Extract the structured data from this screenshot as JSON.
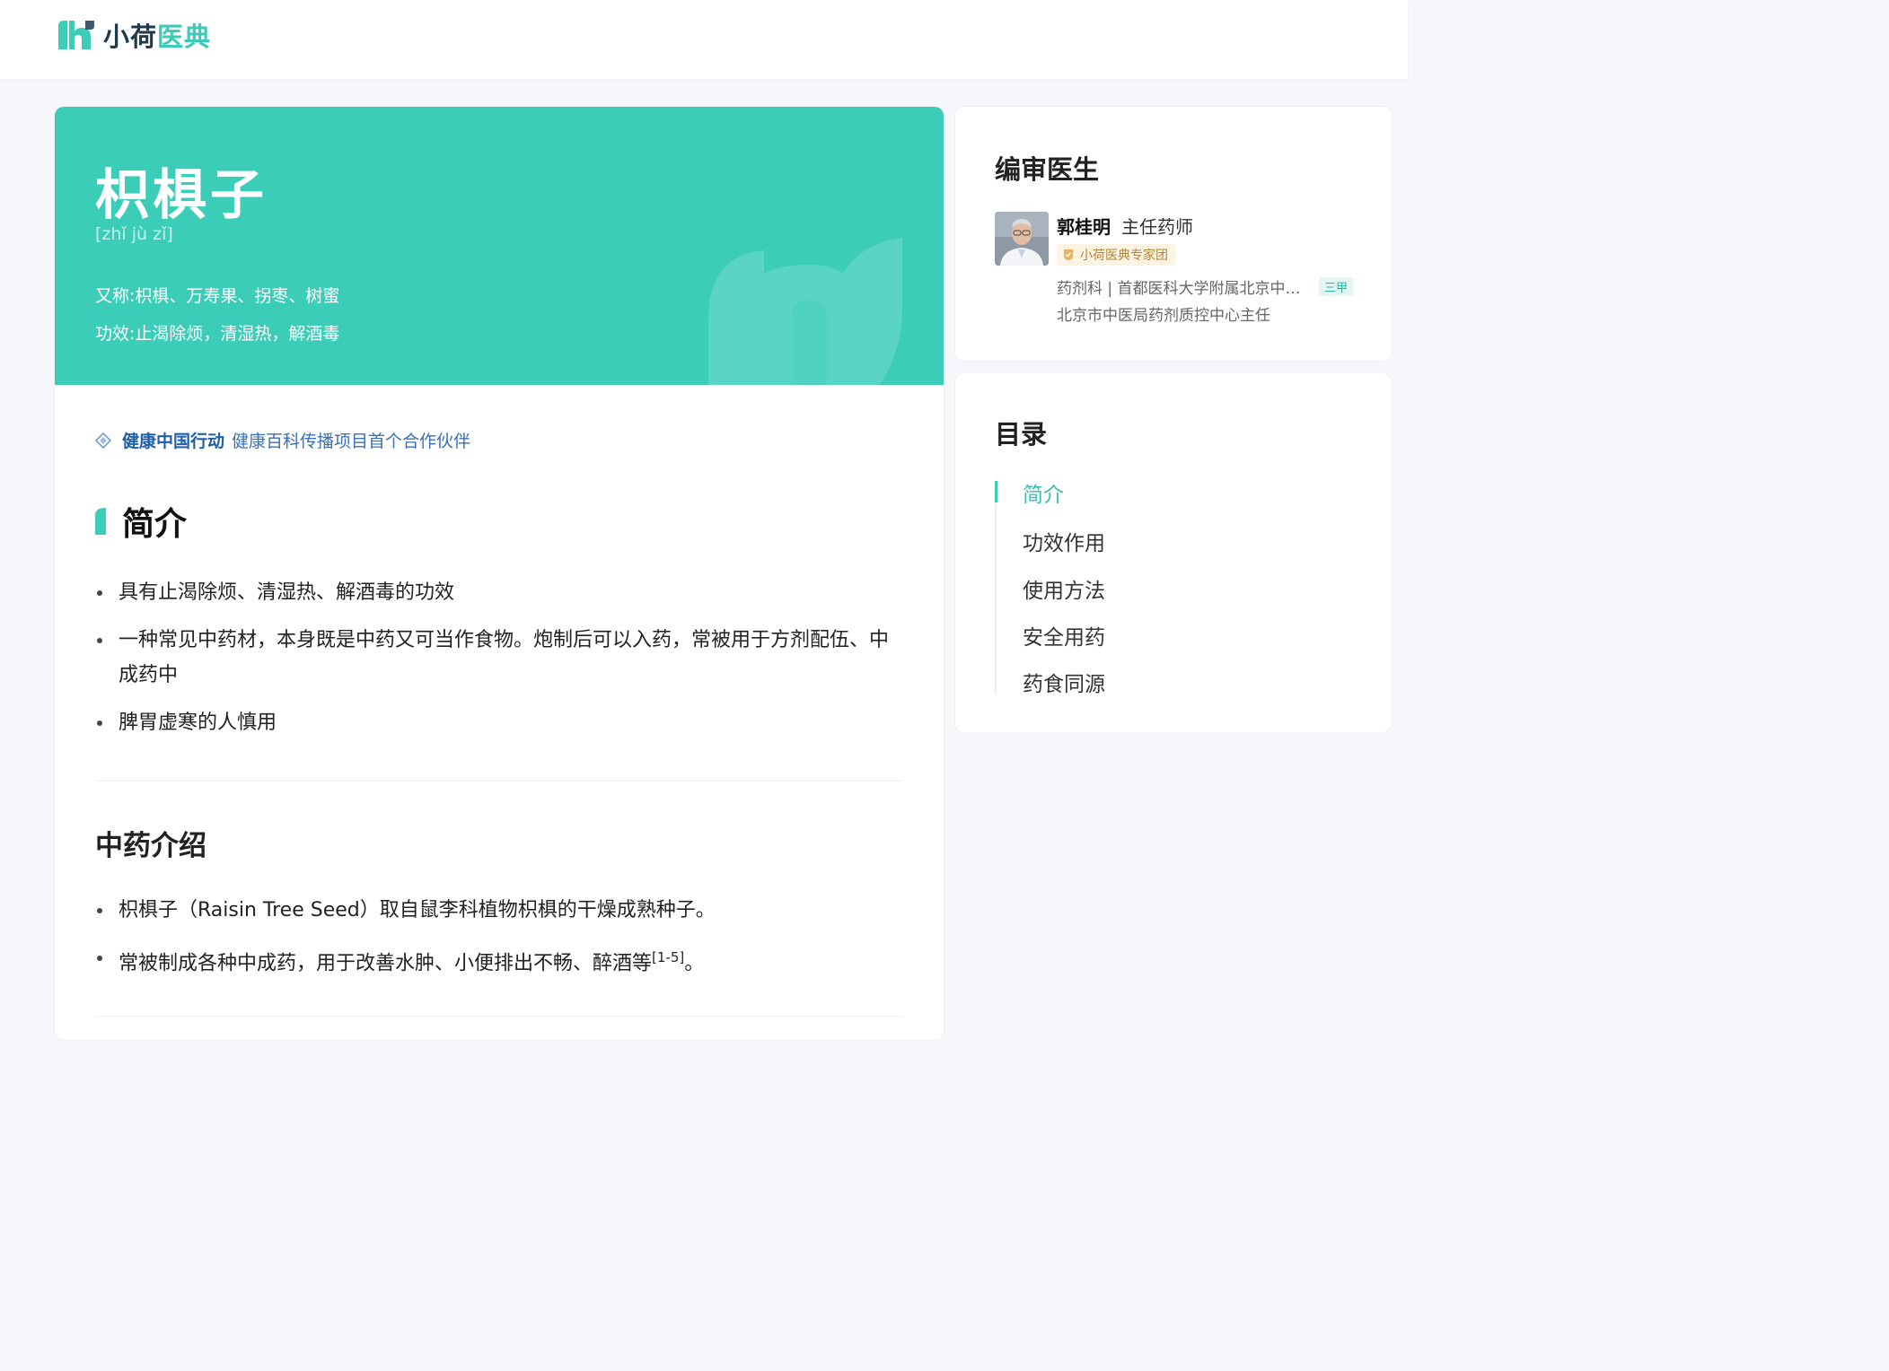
{
  "brand": {
    "name_part1": "小荷",
    "name_part2": "医典",
    "accent": "#3ccdb8"
  },
  "herb": {
    "name": "枳椇子",
    "pinyin": "[zhǐ jù zǐ]",
    "aka_label": "又称:",
    "aka": "枳椇、万寿果、拐枣、树蜜",
    "effect_label": "功效:",
    "effect": "止渴除烦，清湿热，解酒毒"
  },
  "partner": {
    "icon": "diamond-icon",
    "strong": "健康中国行动",
    "text": "健康百科传播项目首个合作伙伴"
  },
  "intro": {
    "title": "简介",
    "items": [
      "具有止渴除烦、清湿热、解酒毒的功效",
      "一种常见中药材，本身既是中药又可当作食物。炮制后可以入药，常被用于方剂配伍、中成药中",
      "脾胃虚寒的人慎用"
    ]
  },
  "herb_intro": {
    "title": "中药介绍",
    "items": [
      "枳椇子（Raisin Tree Seed）取自鼠李科植物枳椇的干燥成熟种子。",
      "常被制成各种中成药，用于改善水肿、小便排出不畅、醉酒等"
    ],
    "ref": "[1-5]",
    "end_punct": "。"
  },
  "reviewer": {
    "section_title": "编审医生",
    "name": "郭桂明",
    "title": "主任药师",
    "badge": "小荷医典专家团",
    "dept": "药剂科 | 首都医科大学附属北京中医医院",
    "grade": "三甲",
    "role": "北京市中医局药剂质控中心主任"
  },
  "toc": {
    "title": "目录",
    "items": [
      "简介",
      "功效作用",
      "使用方法",
      "安全用药",
      "药食同源"
    ],
    "active_index": 0
  }
}
